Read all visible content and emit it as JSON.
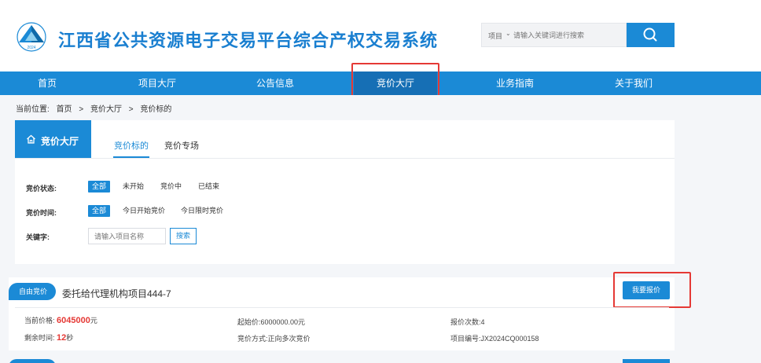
{
  "site": {
    "title": "江西省公共资源电子交易平台综合产权交易系统",
    "logo_year": "2024"
  },
  "search": {
    "type_label": "项目",
    "placeholder": "请输入关键词进行搜索",
    "button_icon": "search-icon"
  },
  "nav": {
    "items": [
      "首页",
      "项目大厅",
      "公告信息",
      "竞价大厅",
      "业务指南",
      "关于我们"
    ],
    "active": "竞价大厅"
  },
  "breadcrumb": {
    "prefix": "当前位置:",
    "items": [
      "首页",
      "竞价大厅",
      "竞价标的"
    ],
    "separator": ">"
  },
  "hall": {
    "title": "竞价大厅",
    "tabs": [
      "竞价标的",
      "竞价专场"
    ],
    "active_tab": "竞价标的"
  },
  "filters": {
    "status": {
      "label": "竞价状态:",
      "options": [
        "全部",
        "未开始",
        "竞价中",
        "已结束"
      ],
      "selected": "全部"
    },
    "time": {
      "label": "竞价时间:",
      "options": [
        "全部",
        "今日开始竞价",
        "今日限时竞价"
      ],
      "selected": "全部"
    },
    "keyword": {
      "label": "关键字:",
      "placeholder": "请输入项目名称",
      "button": "搜索"
    }
  },
  "listing": {
    "badge": "自由竞价",
    "title": "委托给代理机构项目444-7",
    "bid_button": "我要报价",
    "current_price_label": "当前价格:",
    "current_price_value": "6045000",
    "current_price_unit": "元",
    "remaining_label": "剩余时间:",
    "remaining_value": "12",
    "remaining_unit": "秒",
    "start_price": "起始价:6000000.00元",
    "bid_mode": "竞价方式:正向多次竞价",
    "bid_count": "报价次数:4",
    "project_no": "项目编号:JX2024CQ000158"
  },
  "colors": {
    "primary": "#1b8ad6",
    "nav_active": "#166fb5",
    "highlight": "#e53935",
    "price": "#e53935"
  }
}
